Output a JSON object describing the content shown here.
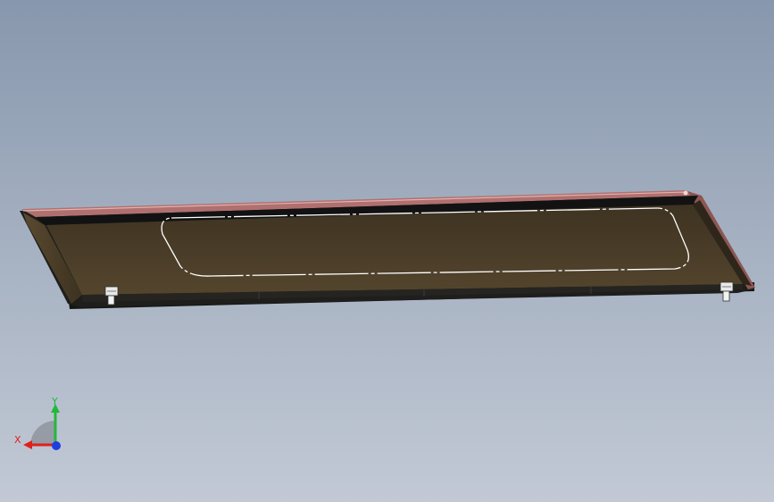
{
  "viewport": {
    "background_top": "#8797ad",
    "background_bottom": "#c2c9d5"
  },
  "model": {
    "panel_color": "#4a3d28",
    "rim_color": "#1e1e1c",
    "gasket_color": "#b07070",
    "outline_color": "#ffffff"
  },
  "triad": {
    "x_label": "X",
    "y_label": "Y",
    "x_color": "#e0201c",
    "y_color": "#22b83a",
    "z_color": "#1f3ee0"
  }
}
